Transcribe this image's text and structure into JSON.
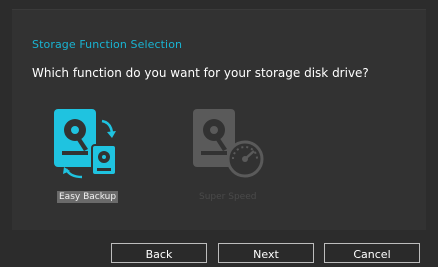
{
  "dialog": {
    "title": "Storage Function Selection",
    "question": "Which function do you want for your storage disk drive?"
  },
  "options": [
    {
      "label": "Easy Backup",
      "icon": "backup-drive-icon",
      "state": "selected"
    },
    {
      "label": "Super Speed",
      "icon": "speed-drive-icon",
      "state": "disabled"
    }
  ],
  "buttons": {
    "back": "Back",
    "next": "Next",
    "cancel": "Cancel"
  },
  "colors": {
    "accent": "#19b4d2",
    "background": "#2c2c2c",
    "disabled": "#5a5a5a"
  }
}
